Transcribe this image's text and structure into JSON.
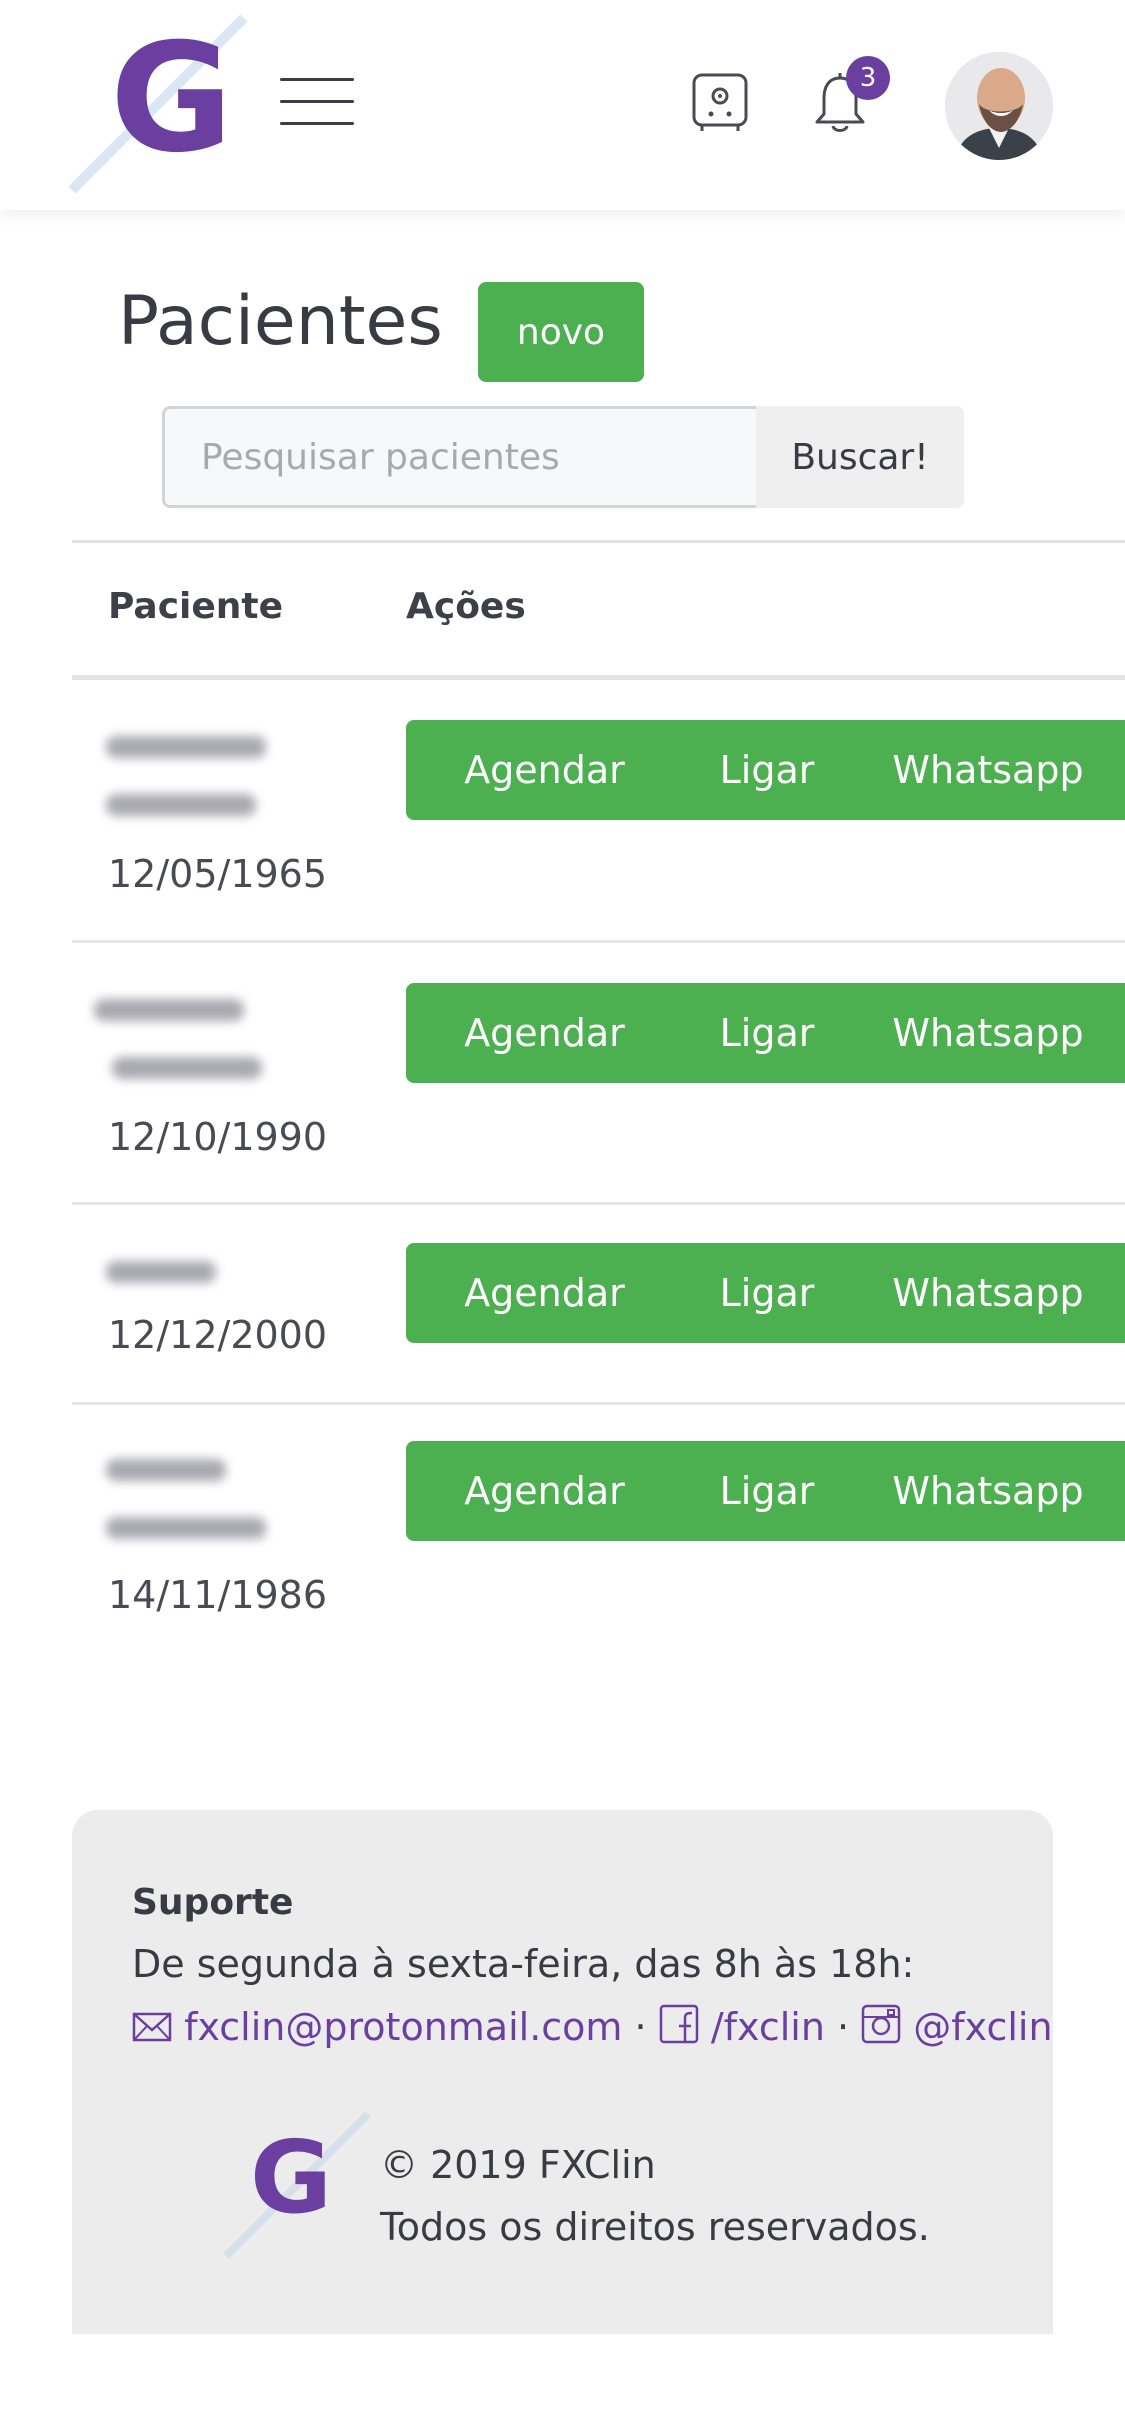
{
  "header": {
    "logo_letter": "G",
    "notification_count": "3",
    "brand_color": "#6b3fa0"
  },
  "page": {
    "title": "Pacientes",
    "new_button": "novo",
    "search_placeholder": "Pesquisar pacientes",
    "search_button": "Buscar!"
  },
  "table": {
    "headers": [
      "Paciente",
      "Ações"
    ],
    "action_labels": [
      "Agendar",
      "Ligar",
      "Whatsapp"
    ],
    "action_color": "#4caf50",
    "rows": [
      {
        "birthdate": "12/05/1965"
      },
      {
        "birthdate": "12/10/1990"
      },
      {
        "birthdate": "12/12/2000"
      },
      {
        "birthdate": "14/11/1986"
      }
    ]
  },
  "footer": {
    "support_title": "Suporte",
    "hours": "De segunda à sexta-feira, das 8h às 18h:",
    "email": "fxclin@protonmail.com",
    "facebook": "/fxclin",
    "instagram": "@fxclin",
    "separator": "·",
    "copyright": "© 2019 FXClin",
    "rights": "Todos os direitos reservados.",
    "logo_letter": "G"
  },
  "icons": [
    "menu-icon",
    "safe-icon",
    "bell-icon",
    "mail-icon",
    "facebook-icon",
    "instagram-icon"
  ]
}
